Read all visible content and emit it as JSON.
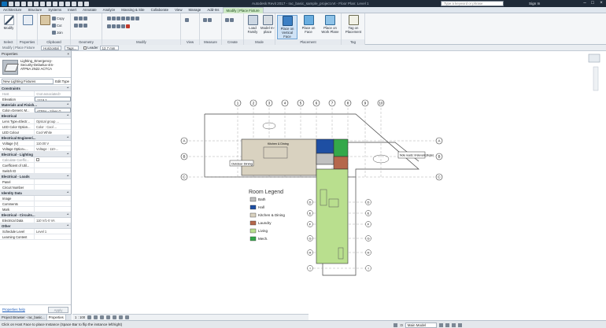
{
  "titlebar": {
    "title": "Autodesk Revit 2017 - rac_basic_sample_project.rvt - Floor Plan: Level 1",
    "search_placeholder": "Type a keyword or phrase",
    "sign_in": "Sign In"
  },
  "ribbon_tabs": [
    "Architecture",
    "Structure",
    "Systems",
    "Insert",
    "Annotate",
    "Analyze",
    "Massing & Site",
    "Collaborate",
    "View",
    "Manage",
    "Add-Ins",
    "Modify | Place Fixture"
  ],
  "ribbon": {
    "select_label": "Select",
    "modify_label": "Modify",
    "properties_panel": "Properties",
    "clipboard_panel": "Clipboard",
    "geometry_panel": "Geometry",
    "modify_panel": "Modify",
    "view_panel": "View",
    "measure_panel": "Measure",
    "create_panel": "Create",
    "mode_panel": "Mode",
    "placement_panel": "Placement",
    "tag_panel": "Tag",
    "clip_copy": "Copy",
    "clip_cut": "Cut",
    "clip_join": "Join",
    "load_family": "Load Family",
    "model_inplace": "Model In-place",
    "place_vertical": "Place on Vertical Face",
    "place_face": "Place on Face",
    "place_workplane": "Place on Work Plane",
    "tag_on_placement": "Tag on Placement"
  },
  "optionsbar": {
    "context": "Modify | Place Fixture",
    "orientation": "Horizontal",
    "tags": "Tags...",
    "leader": "Leader",
    "leader_length": "12.7 mm"
  },
  "properties": {
    "title": "Properties",
    "close": "×",
    "type_name_1": "Lighting_Emergency-",
    "type_name_2": "Security-Delaelux-4m-",
    "type_name_3": "ATP6A 2N22 ACTCA",
    "instance_select": "New Lighting Fixtures",
    "edit_type": "Edit Type",
    "groups": [
      {
        "name": "Constraints",
        "rows": [
          {
            "k": "Host",
            "v": "<not associated>",
            "dim": true
          },
          {
            "k": "Elevation",
            "v": "1219.2",
            "boxed": true
          }
        ]
      },
      {
        "name": "Materials and Finish...",
        "rows": [
          {
            "k": "Color=Generic M...",
            "v": "ATP6A - Silver G...",
            "boxed": true
          }
        ]
      },
      {
        "name": "Electrical",
        "rows": [
          {
            "k": "Lens Type=Electr...",
            "v": "Optical group ..."
          },
          {
            "k": "LED Color Option...",
            "v": "Color : Cool ..."
          },
          {
            "k": "LED Colour",
            "v": "Cool White"
          }
        ]
      },
      {
        "name": "Electrical Engineeri...",
        "rows": [
          {
            "k": "Voltage (V)",
            "v": "110.00 V"
          },
          {
            "k": "Voltage Option=...",
            "v": "Voltage : 110-..."
          }
        ]
      },
      {
        "name": "Electrical - Lighting",
        "rows": [
          {
            "k": "Calculate Coeffic...",
            "v": "",
            "dim": true,
            "chk": true
          },
          {
            "k": "Coefficient of Util...",
            "v": ""
          },
          {
            "k": "Switch ID",
            "v": ""
          }
        ]
      },
      {
        "name": "Electrical - Loads",
        "rows": [
          {
            "k": "Panel",
            "v": ""
          },
          {
            "k": "Circuit Number",
            "v": ""
          }
        ]
      },
      {
        "name": "Identity Data",
        "rows": [
          {
            "k": "Image",
            "v": ""
          },
          {
            "k": "Comments",
            "v": ""
          },
          {
            "k": "Mark",
            "v": ""
          }
        ]
      },
      {
        "name": "Electrical - Circuits...",
        "rows": [
          {
            "k": "Electrical Data",
            "v": "110 V/1-0 VA"
          }
        ]
      },
      {
        "name": "Other",
        "rows": [
          {
            "k": "Schedule Level",
            "v": "Level 1"
          },
          {
            "k": "Learning Content",
            "v": ""
          }
        ]
      }
    ],
    "help": "Properties help",
    "apply": "Apply"
  },
  "bottom_tabs": [
    "Project Browser - rac_basic...",
    "Properties"
  ],
  "view_control": {
    "scale": "1 : 100"
  },
  "plan": {
    "grid_top": [
      "1",
      "2",
      "3",
      "4",
      "5",
      "6",
      "7",
      "8",
      "9",
      "10"
    ],
    "grid_left": [
      "A",
      "B",
      "C"
    ],
    "grid_right": [
      "A",
      "B",
      "C"
    ],
    "grid_lower": [
      "D",
      "E",
      "F",
      "G",
      "H",
      "I"
    ],
    "room_tag": "Outdoor Dining",
    "kitchen_tag": "Kitchen & Dining",
    "note_tag": "Note reads: Irrelevant Model",
    "legend_title": "Room Legend",
    "legend": [
      {
        "label": "Bath",
        "color": "#c0c0c0"
      },
      {
        "label": "Hall",
        "color": "#1e4fa3"
      },
      {
        "label": "Kitchen & Dining",
        "color": "#d9d2c0"
      },
      {
        "label": "Laundry",
        "color": "#b5674b"
      },
      {
        "label": "Living",
        "color": "#b9df8e"
      },
      {
        "label": "Mech.",
        "color": "#34a84a"
      }
    ]
  },
  "status": {
    "message": "Click on Host Face to place Instance (Space Bar to flip the instance left/right)",
    "model": "Main Model",
    "zero": ":0"
  }
}
